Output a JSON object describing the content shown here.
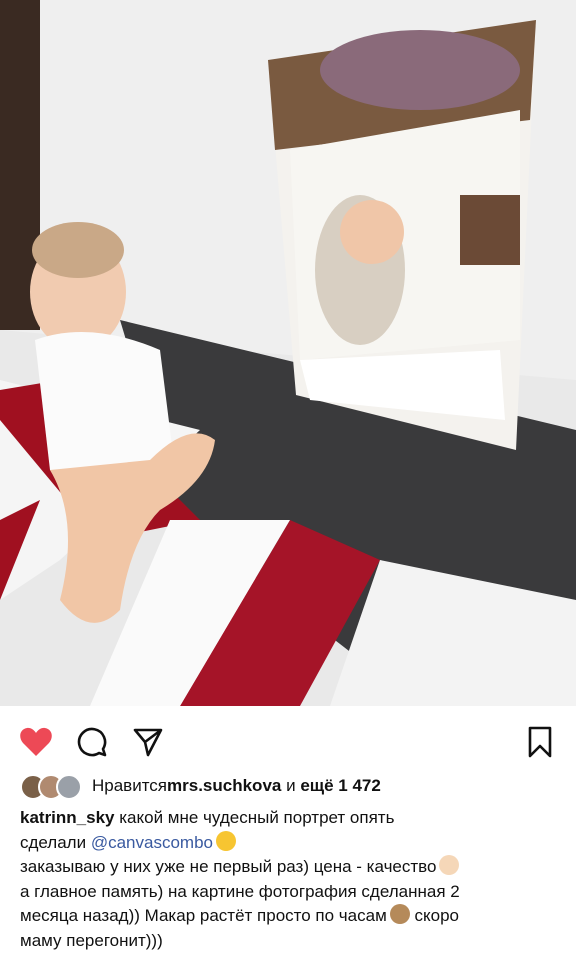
{
  "post": {
    "image_description": "",
    "likes": {
      "prefix": "Нравится ",
      "user": "mrs.suchkova",
      "middle": " и ",
      "count": "ещё 1 472"
    },
    "caption": {
      "username": "katrinn_sky",
      "line1": " какой мне чудесный портрет опять",
      "line2_pre": "сделали ",
      "mention": "@canvascombo",
      "line3": "заказываю у них уже не первый раз) цена - качество",
      "line4": "а главное память) на картине фотография сделанная 2",
      "line5": "месяца назад)) Макар растёт просто по часам",
      "line5_post": " скоро",
      "line6": "маму перегонит)))"
    },
    "icons": {
      "like": "heart-icon",
      "comment": "comment-icon",
      "share": "send-icon",
      "save": "bookmark-icon"
    },
    "colors": {
      "heart": "#ed4956",
      "mention": "#3a5aa0"
    }
  }
}
